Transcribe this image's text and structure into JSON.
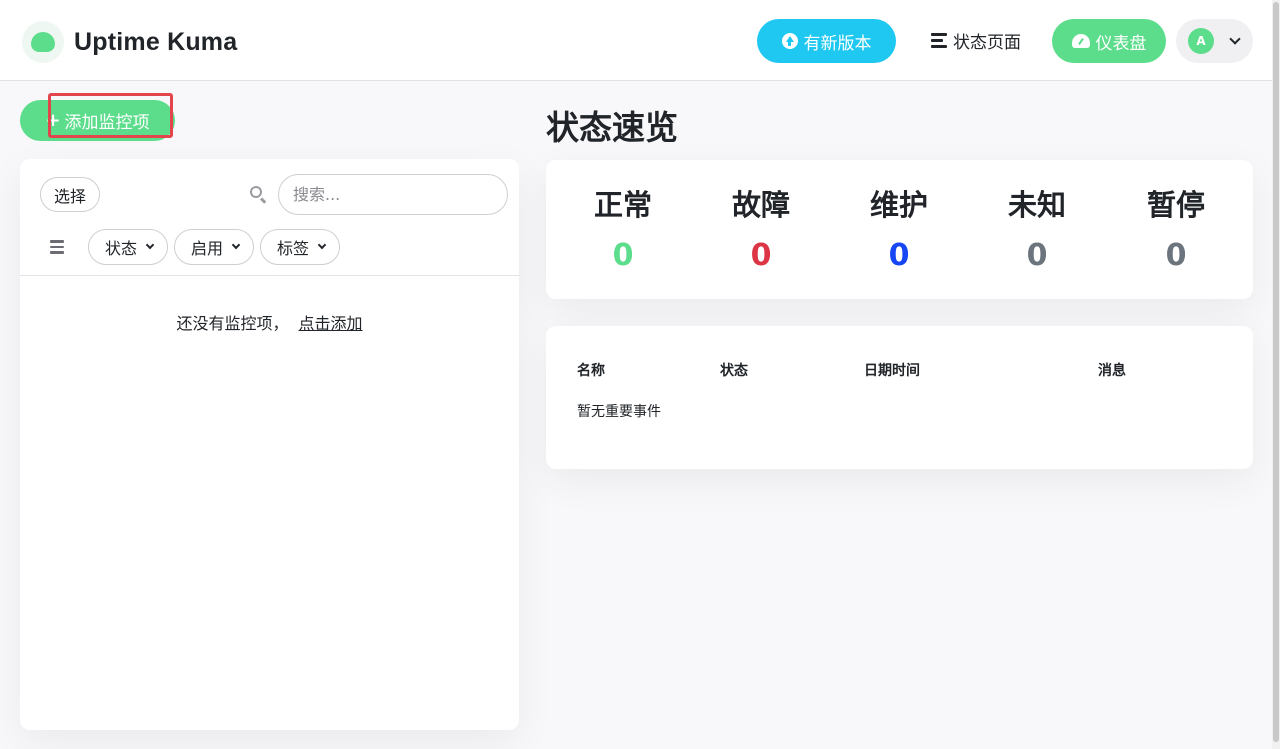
{
  "header": {
    "brand_title": "Uptime Kuma",
    "update_label": "有新版本",
    "status_page_label": "状态页面",
    "dashboard_label": "仪表盘",
    "avatar_initial": "A"
  },
  "sidebar": {
    "add_monitor_label": "添加监控项",
    "select_label": "选择",
    "search_placeholder": "搜索...",
    "filters": [
      {
        "label": "状态"
      },
      {
        "label": "启用"
      },
      {
        "label": "标签"
      }
    ],
    "empty_text": "还没有监控项，",
    "empty_link": "点击添加"
  },
  "overview": {
    "title": "状态速览",
    "stats": [
      {
        "label": "正常",
        "value": "0",
        "color": "#5cdd8b"
      },
      {
        "label": "故障",
        "value": "0",
        "color": "#dc3545"
      },
      {
        "label": "维护",
        "value": "0",
        "color": "#1747f5"
      },
      {
        "label": "未知",
        "value": "0",
        "color": "#6c757d"
      },
      {
        "label": "暂停",
        "value": "0",
        "color": "#6c757d"
      }
    ]
  },
  "events": {
    "columns": [
      "名称",
      "状态",
      "日期时间",
      "消息"
    ],
    "empty_text": "暂无重要事件"
  },
  "colors": {
    "primary": "#5cdd8b",
    "info": "#1ec8f0",
    "danger": "#dc3545"
  },
  "icons": {
    "update": "arrow-up-circle-icon",
    "status_page": "list-icon",
    "dashboard": "gauge-icon",
    "search": "search-icon",
    "menu": "menu-icon"
  }
}
